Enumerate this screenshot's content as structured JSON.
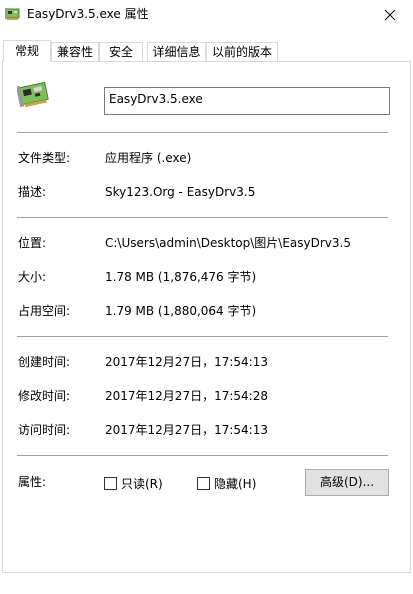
{
  "window": {
    "title": "EasyDrv3.5.exe 属性",
    "close_glyph": "✕"
  },
  "tabs": [
    {
      "label": "常规",
      "active": true
    },
    {
      "label": "兼容性"
    },
    {
      "label": "安全"
    },
    {
      "label": "详细信息"
    },
    {
      "label": "以前的版本"
    }
  ],
  "general": {
    "file_name": "EasyDrv3.5.exe",
    "rows": {
      "file_type": {
        "label": "文件类型:",
        "value": "应用程序 (.exe)"
      },
      "description": {
        "label": "描述:",
        "value": "Sky123.Org - EasyDrv3.5"
      },
      "location": {
        "label": "位置:",
        "value": "C:\\Users\\admin\\Desktop\\图片\\EasyDrv3.5"
      },
      "size": {
        "label": "大小:",
        "value": "1.78 MB (1,876,476 字节)"
      },
      "size_on_disk": {
        "label": "占用空间:",
        "value": "1.79 MB (1,880,064 字节)"
      },
      "created": {
        "label": "创建时间:",
        "value": "2017年12月27日，17:54:13"
      },
      "modified": {
        "label": "修改时间:",
        "value": "2017年12月27日，17:54:28"
      },
      "accessed": {
        "label": "访问时间:",
        "value": "2017年12月27日，17:54:13"
      }
    },
    "attributes": {
      "label": "属性:",
      "readonly": {
        "label": "只读(R)",
        "checked": false
      },
      "hidden": {
        "label": "隐藏(H)",
        "checked": false
      },
      "advanced_button": "高级(D)..."
    }
  },
  "icons": {
    "app": "circuit-board-icon",
    "file": "circuit-board-icon",
    "close": "close-icon"
  }
}
